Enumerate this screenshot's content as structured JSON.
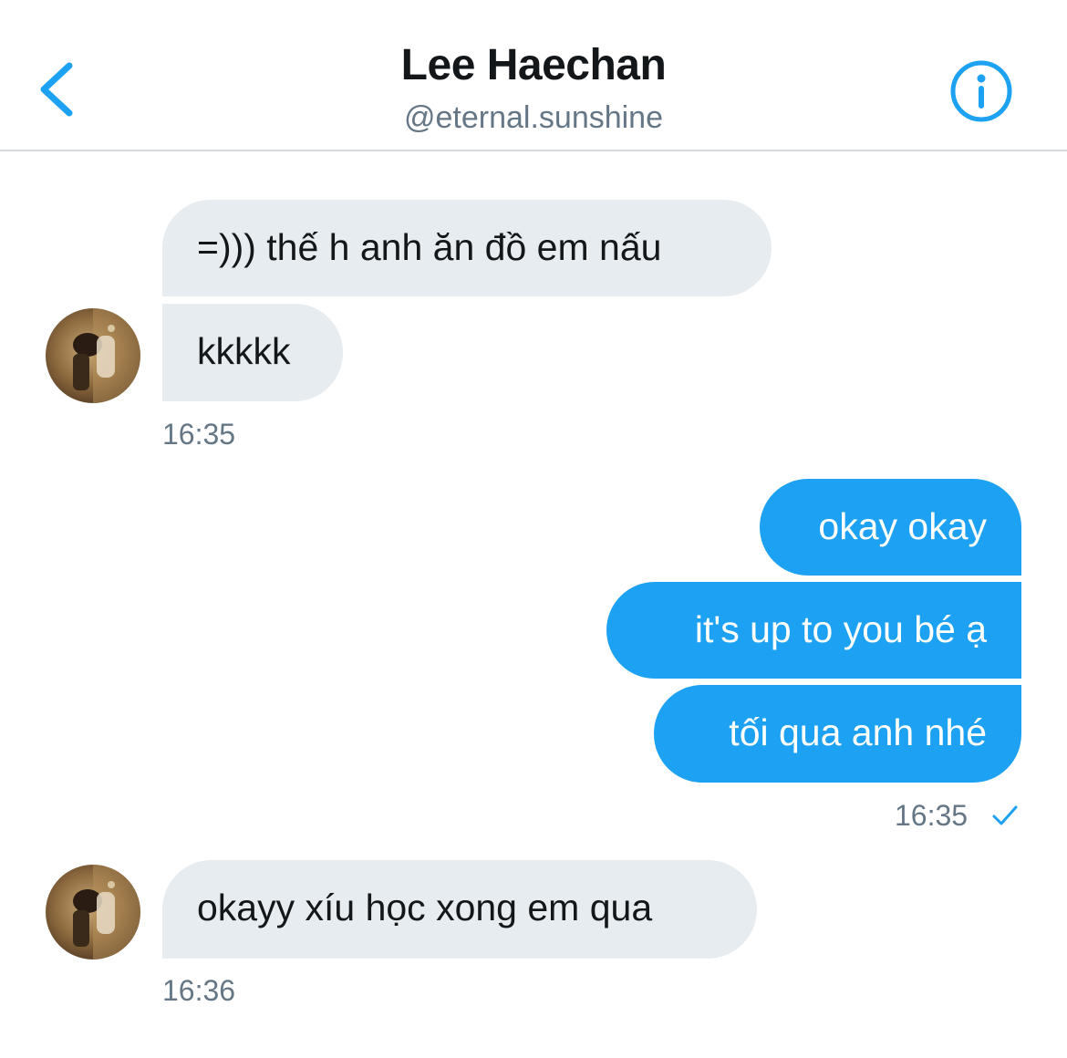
{
  "header": {
    "title": "Lee Haechan",
    "handle": "@eternal.sunshine",
    "back_icon": "chevron-left-icon",
    "info_icon": "info-icon",
    "accent_color": "#1da1f2"
  },
  "messages": [
    {
      "side": "in",
      "text": "=))) thế h anh ăn đồ em nấu"
    },
    {
      "side": "in",
      "text": "kkkkk"
    },
    {
      "side": "in-time",
      "text": "16:35"
    },
    {
      "side": "out",
      "text": "okay okay"
    },
    {
      "side": "out",
      "text": "it's up to you bé ạ"
    },
    {
      "side": "out",
      "text": "tối qua anh nhé"
    },
    {
      "side": "out-time",
      "text": "16:35"
    },
    {
      "side": "in",
      "text": "okayy xíu học xong em qua"
    },
    {
      "side": "in-time",
      "text": "16:36"
    }
  ],
  "colors": {
    "incoming_bubble": "#e6ecf0",
    "outgoing_bubble": "#1da1f2",
    "timestamp": "#657786"
  }
}
